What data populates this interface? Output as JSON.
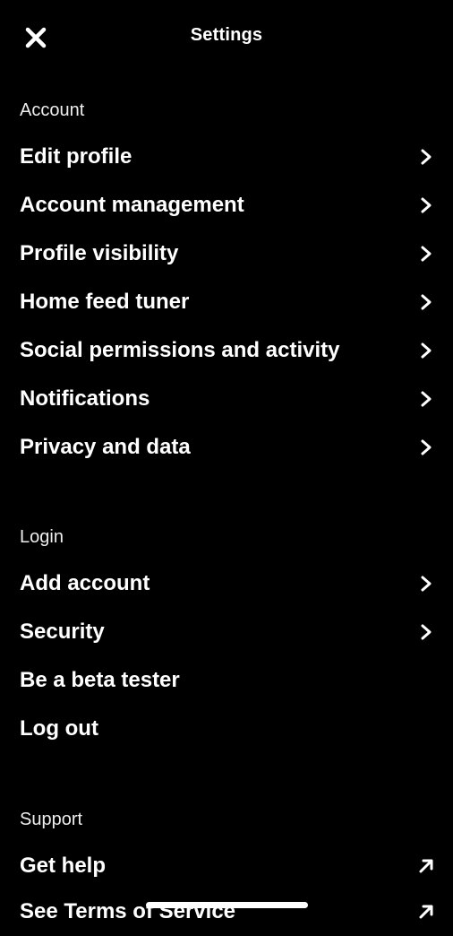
{
  "header": {
    "title": "Settings",
    "close_icon": "close-icon"
  },
  "sections": [
    {
      "label": "Account",
      "items": [
        {
          "label": "Edit profile",
          "icon": "chevron-right"
        },
        {
          "label": "Account management",
          "icon": "chevron-right"
        },
        {
          "label": "Profile visibility",
          "icon": "chevron-right"
        },
        {
          "label": "Home feed tuner",
          "icon": "chevron-right"
        },
        {
          "label": "Social permissions and activity",
          "icon": "chevron-right"
        },
        {
          "label": "Notifications",
          "icon": "chevron-right"
        },
        {
          "label": "Privacy and data",
          "icon": "chevron-right"
        }
      ]
    },
    {
      "label": "Login",
      "items": [
        {
          "label": "Add account",
          "icon": "chevron-right"
        },
        {
          "label": "Security",
          "icon": "chevron-right"
        },
        {
          "label": "Be a beta tester",
          "icon": ""
        },
        {
          "label": "Log out",
          "icon": ""
        }
      ]
    },
    {
      "label": "Support",
      "items": [
        {
          "label": "Get help",
          "icon": "external-arrow"
        },
        {
          "label": "See Terms of Service",
          "icon": "external-arrow"
        }
      ]
    }
  ]
}
